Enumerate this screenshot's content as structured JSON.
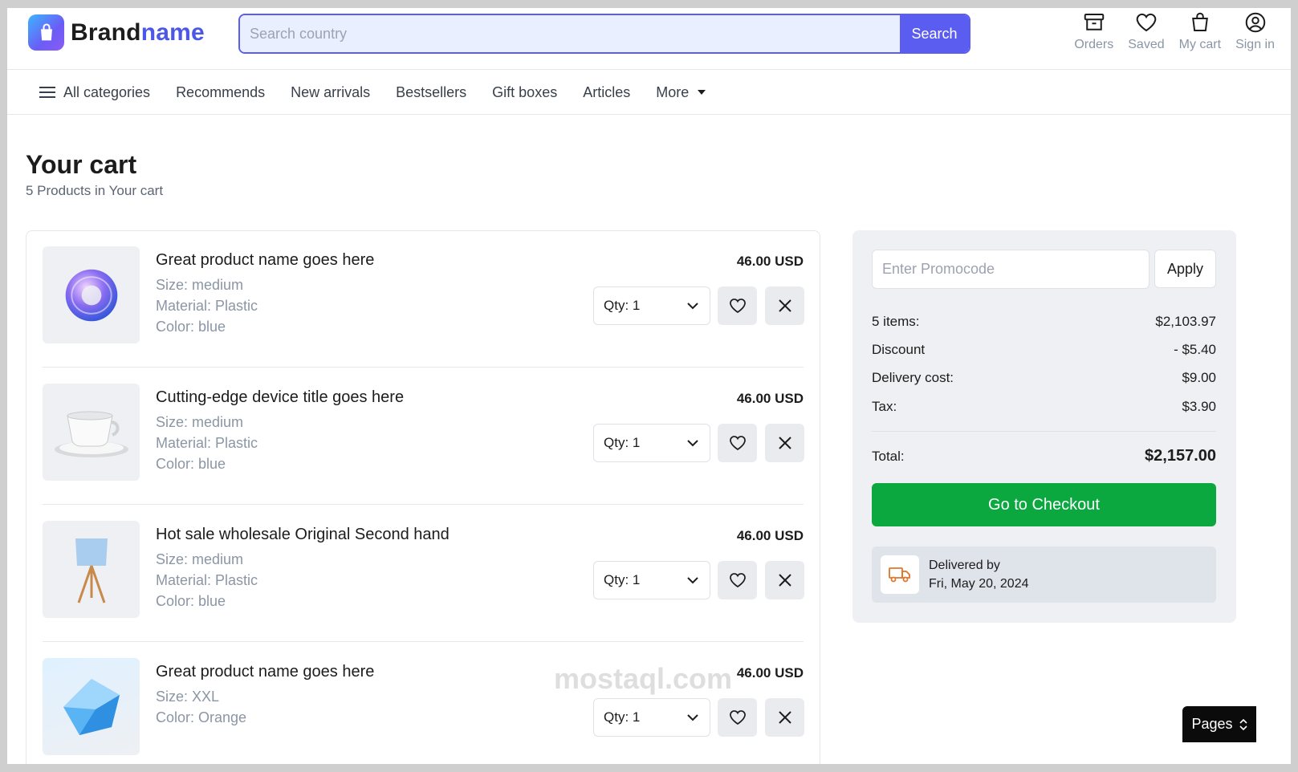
{
  "brand": {
    "name_part1": "Brand",
    "name_part2": "name"
  },
  "search": {
    "placeholder": "Search country",
    "button_label": "Search"
  },
  "header_actions": [
    {
      "icon": "orders-icon",
      "label": "Orders"
    },
    {
      "icon": "heart-icon",
      "label": "Saved"
    },
    {
      "icon": "cart-icon",
      "label": "My cart"
    },
    {
      "icon": "user-icon",
      "label": "Sign in"
    }
  ],
  "nav": {
    "all_categories": "All categories",
    "items": [
      "Recommends",
      "New arrivals",
      "Bestsellers",
      "Gift boxes",
      "Articles"
    ],
    "more": "More"
  },
  "cart": {
    "title": "Your cart",
    "subtitle": "5 Products in Your cart",
    "items": [
      {
        "name": "Great product name goes here",
        "attrs": [
          "Size: medium",
          "Material: Plastic",
          "Color: blue"
        ],
        "price": "46.00 USD",
        "qty": "Qty: 1"
      },
      {
        "name": "Cutting-edge device title goes here",
        "attrs": [
          "Size: medium",
          "Material: Plastic",
          "Color: blue"
        ],
        "price": "46.00 USD",
        "qty": "Qty: 1"
      },
      {
        "name": "Hot sale wholesale Original Second hand",
        "attrs": [
          "Size: medium",
          "Material: Plastic",
          "Color: blue"
        ],
        "price": "46.00 USD",
        "qty": "Qty: 1"
      },
      {
        "name": "Great product name goes here",
        "attrs": [
          "Size: XXL",
          "Color: Orange",
          ""
        ],
        "price": "46.00 USD",
        "qty": "Qty: 1"
      }
    ]
  },
  "summary": {
    "promo_placeholder": "Enter Promocode",
    "apply_label": "Apply",
    "rows": [
      {
        "label": "5 items:",
        "value": "$2,103.97"
      },
      {
        "label": "Discount",
        "value": "- $5.40"
      },
      {
        "label": "Delivery cost:",
        "value": "$9.00"
      },
      {
        "label": "Tax:",
        "value": "$3.90"
      }
    ],
    "total_label": "Total:",
    "total_value": "$2,157.00",
    "checkout_label": "Go to Checkout",
    "delivery_label": "Delivered by",
    "delivery_date": "Fri, May 20, 2024"
  },
  "watermark": "mostaql.com",
  "pages_label": "Pages",
  "colors": {
    "accent": "#5b5df0",
    "checkout": "#0aa83f",
    "muted": "#8b96a5",
    "truck": "#e0752b"
  }
}
